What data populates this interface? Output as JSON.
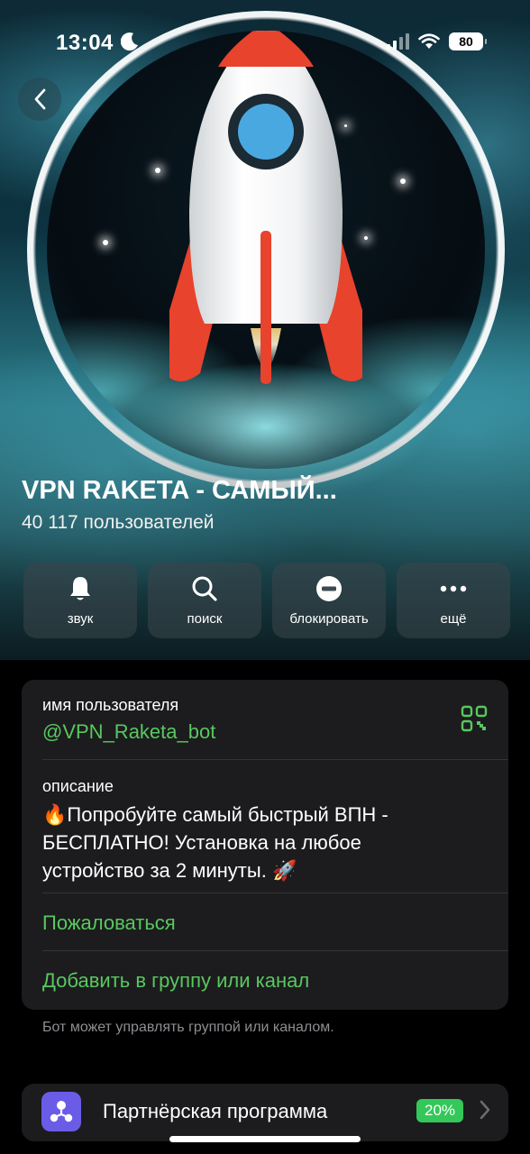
{
  "status_bar": {
    "time": "13:04",
    "battery": "80"
  },
  "profile": {
    "name": "VPN RAKETA - САМЫЙ...",
    "members": "40 117 пользователей"
  },
  "actions": [
    {
      "label": "звук",
      "icon": "bell-icon"
    },
    {
      "label": "поиск",
      "icon": "search-icon"
    },
    {
      "label": "блокировать",
      "icon": "block-icon"
    },
    {
      "label": "ещё",
      "icon": "more-icon"
    }
  ],
  "info": {
    "username_label": "имя пользователя",
    "username": "@VPN_Raketa_bot",
    "description_label": "описание",
    "description_line1": "Попробуйте самый быстрый ВПН -",
    "description_line2": "БЕСПЛАТНО! Установка на любое",
    "description_line3": "устройство за 2 минуты.",
    "report": "Пожаловаться",
    "add_to_group": "Добавить в группу или канал"
  },
  "hint": "Бот может управлять группой или каналом.",
  "partner": {
    "label": "Партнёрская программа",
    "badge": "20%"
  },
  "colors": {
    "accent_green": "#58c85f",
    "badge_green": "#34c759",
    "partner_icon_bg": "#6b5ce7",
    "card_bg": "#1c1c1e"
  }
}
